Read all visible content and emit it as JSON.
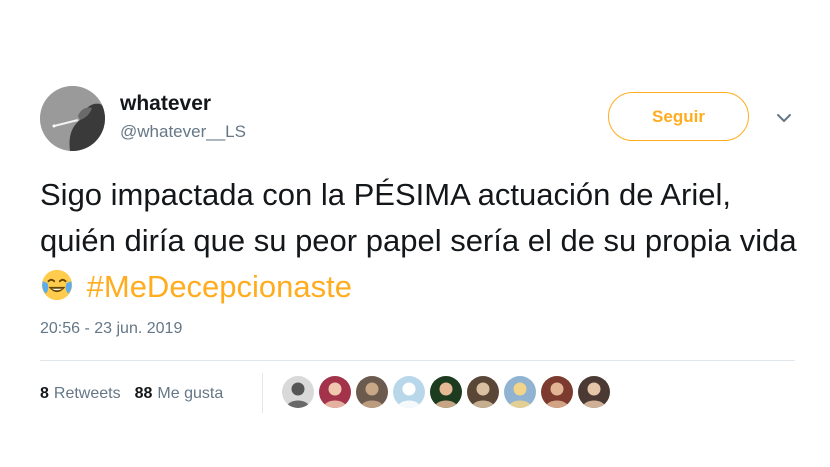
{
  "author": {
    "name": "whatever",
    "handle": "@whatever__LS"
  },
  "follow_label": "Seguir",
  "tweet": {
    "text_main": "Sigo impactada con la PÉSIMA actuación de Ariel, quién diría que su peor papel sería el de su propia vida",
    "emoji": "face-with-tears-of-joy",
    "hashtag": "#MeDecepcionaste",
    "timestamp": "20:56 - 23 jun. 2019"
  },
  "stats": {
    "retweets_count": "8",
    "retweets_label": "Retweets",
    "likes_count": "88",
    "likes_label": "Me gusta"
  },
  "colors": {
    "accent": "#ffad1f",
    "secondary_text": "#657786",
    "divider": "#e1e8ed"
  },
  "likers": [
    {
      "tone": "#d9d9d9",
      "accent": "#555555"
    },
    {
      "tone": "#a3334a",
      "accent": "#f0c8b0"
    },
    {
      "tone": "#6b5a4e",
      "accent": "#c9a888"
    },
    {
      "tone": "#b9d7ea",
      "accent": "#ffffff"
    },
    {
      "tone": "#1d3b1f",
      "accent": "#e5b896"
    },
    {
      "tone": "#5a4636",
      "accent": "#d8c0a0"
    },
    {
      "tone": "#8fb3d1",
      "accent": "#f2d48a"
    },
    {
      "tone": "#7c3b2e",
      "accent": "#e2b694"
    },
    {
      "tone": "#4b3a33",
      "accent": "#e6c6a8"
    }
  ]
}
